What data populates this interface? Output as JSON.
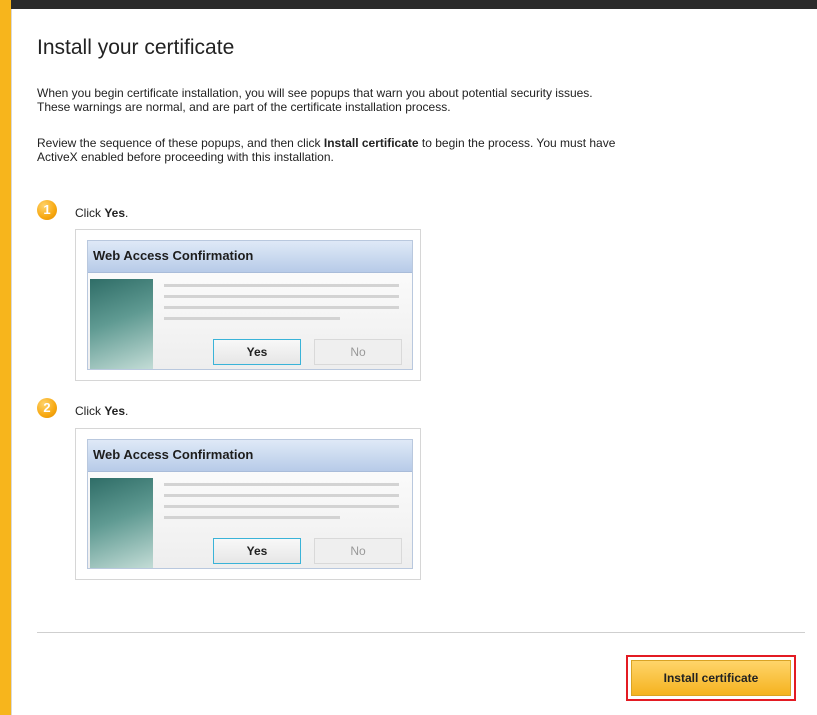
{
  "page": {
    "title": "Install your certificate",
    "paragraph1_line1": "When you begin certificate installation, you will see popups that warn you about potential security issues.",
    "paragraph1_line2": "These warnings are normal, and are part of the certificate installation process.",
    "paragraph2_before": "Review the sequence of these popups, and then click ",
    "paragraph2_bold": "Install certificate",
    "paragraph2_after": " to begin the process. You must have",
    "paragraph2_line2": "ActiveX enabled before proceeding with this installation."
  },
  "steps": [
    {
      "number": "1",
      "text_prefix": "Click ",
      "text_bold": "Yes",
      "text_suffix": ".",
      "dialog": {
        "title": "Web Access Confirmation",
        "yes_label": "Yes",
        "no_label": "No"
      }
    },
    {
      "number": "2",
      "text_prefix": "Click ",
      "text_bold": "Yes",
      "text_suffix": ".",
      "dialog": {
        "title": "Web Access Confirmation",
        "yes_label": "Yes",
        "no_label": "No"
      }
    }
  ],
  "footer": {
    "install_label": "Install certificate"
  },
  "colors": {
    "accent": "#f7b51c",
    "highlight": "#e31b23",
    "dialog_title": "#b7cbe8"
  }
}
